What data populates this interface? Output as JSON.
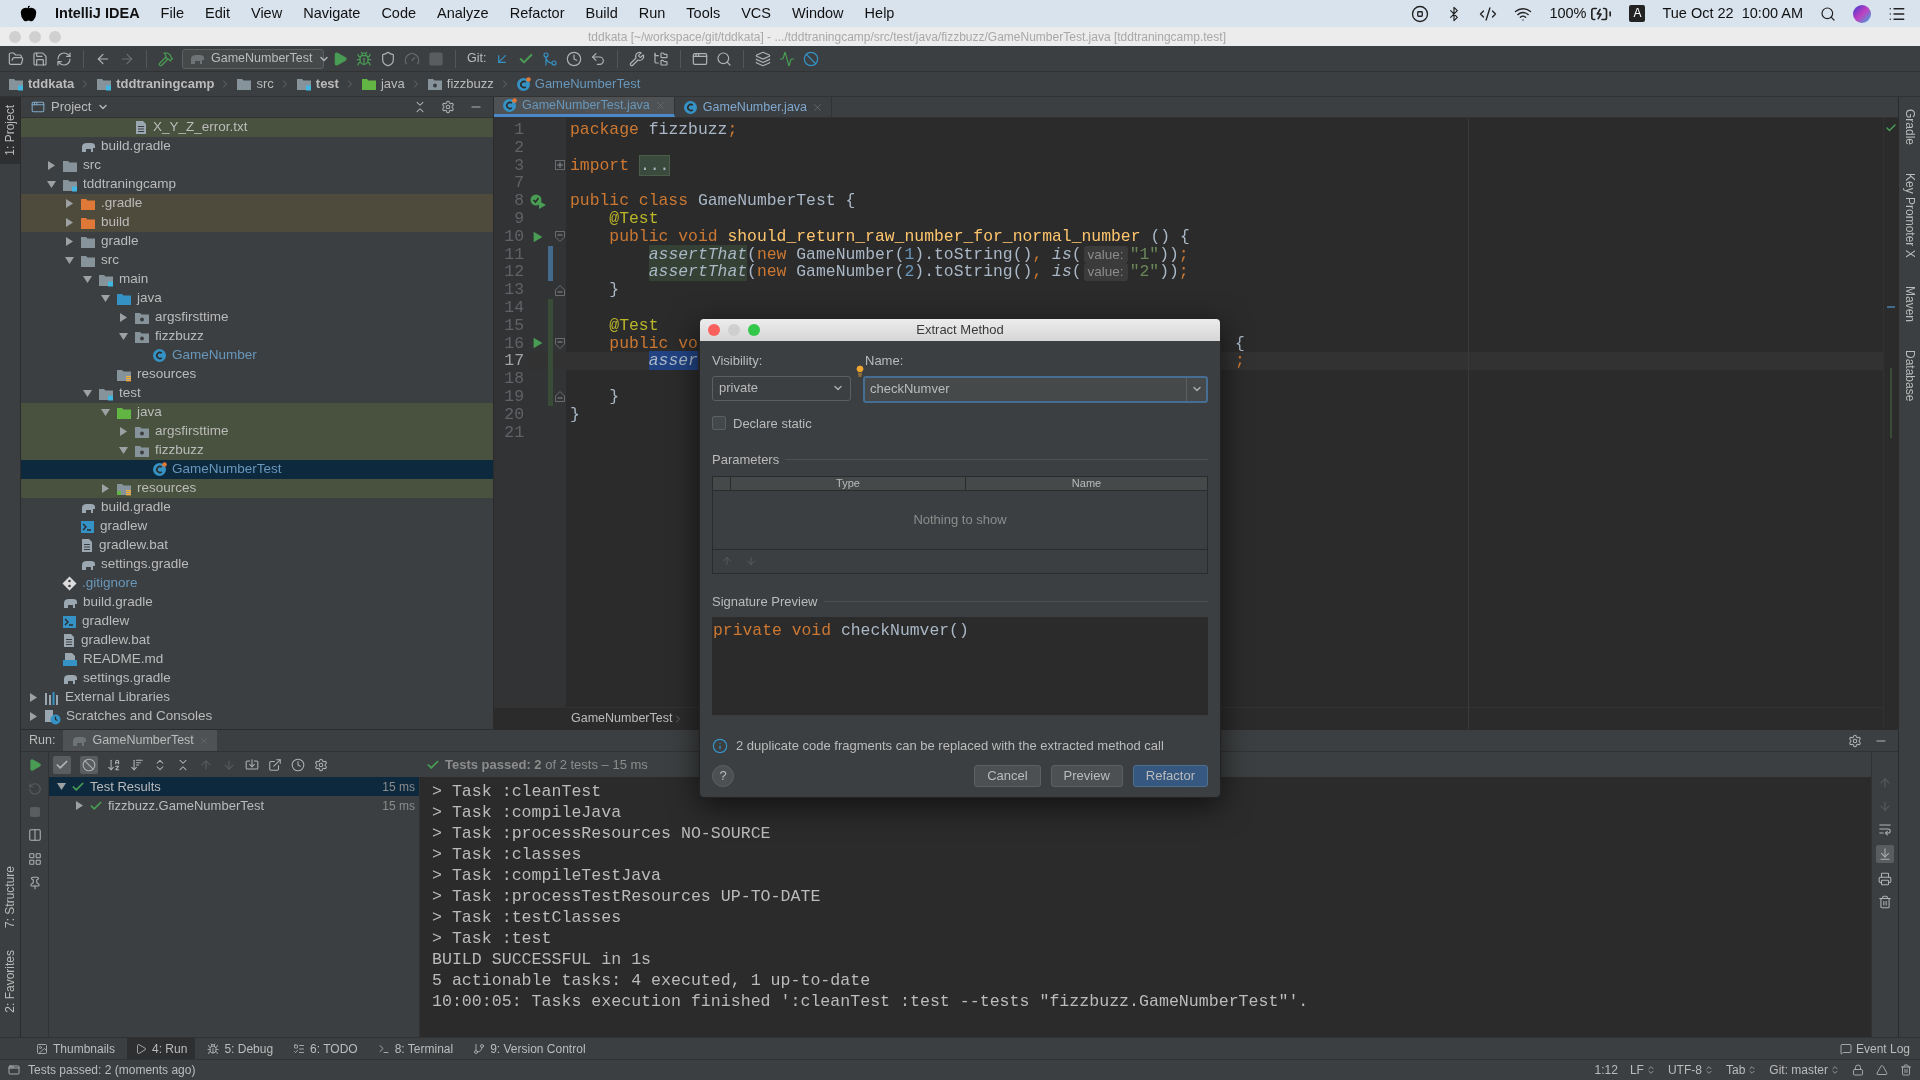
{
  "menu_bar": {
    "app": "IntelliJ IDEA",
    "menus": [
      "File",
      "Edit",
      "View",
      "Navigate",
      "Code",
      "Analyze",
      "Refactor",
      "Build",
      "Run",
      "Tools",
      "VCS",
      "Window",
      "Help"
    ],
    "battery": "100%",
    "input_source": "A",
    "clock": "Tue Oct 22  10:00 AM"
  },
  "window": {
    "title": "tddkata [~/workspace/git/tddkata] - .../tddtraningcamp/src/test/java/fizzbuzz/GameNumberTest.java [tddtraningcamp.test]"
  },
  "toolbar": {
    "run_config": "GameNumberTest",
    "git_label": "Git:"
  },
  "breadcrumbs": [
    {
      "label": "tddkata",
      "kind": "module"
    },
    {
      "label": "tddtraningcamp",
      "kind": "module"
    },
    {
      "label": "src",
      "kind": "folder"
    },
    {
      "label": "test",
      "kind": "module"
    },
    {
      "label": "java",
      "kind": "test_source"
    },
    {
      "label": "fizzbuzz",
      "kind": "package"
    },
    {
      "label": "GameNumberTest",
      "kind": "test_class"
    }
  ],
  "left_stripe": [
    {
      "label": "1: Project",
      "selected": true
    },
    {
      "label": "7: Structure",
      "selected": false
    },
    {
      "label": "2: Favorites",
      "selected": false
    }
  ],
  "right_stripe": [
    {
      "label": "Gradle",
      "selected": false
    },
    {
      "label": "Key Promoter X",
      "selected": false
    },
    {
      "label": "Maven",
      "selected": false
    },
    {
      "label": "Database",
      "selected": false
    }
  ],
  "project": {
    "title": "Project",
    "tree": [
      {
        "children": [
          {
            "children": [
              {
                "children": [
                  {
                    "children": [
                      {
                        "children": [
                          {
                            "label": "X_Y_Z_error.txt",
                            "kind": "text",
                            "selected": false,
                            "modified": false,
                            "color": "#49523f"
                          }
                        ]
                      }
                    ]
                  }
                ]
              },
              {
                "label": "build.gradle",
                "kind": "gradle",
                "selected": false,
                "modified": false
              }
            ]
          },
          {
            "label": "src",
            "kind": "folder",
            "expanded": false,
            "selected": false,
            "modified": false
          },
          {
            "label": "tddtraningcamp",
            "kind": "module",
            "expanded": true,
            "selected": false,
            "modified": false,
            "children": [
              {
                "label": ".gradle",
                "kind": "excluded",
                "expanded": false,
                "selected": false,
                "modified": false,
                "color": "#4e4a3c"
              },
              {
                "label": "build",
                "kind": "excluded",
                "expanded": false,
                "selected": false,
                "modified": false,
                "color": "#4e4a3c"
              },
              {
                "label": "gradle",
                "kind": "folder",
                "expanded": false,
                "selected": false,
                "modified": false
              },
              {
                "label": "src",
                "kind": "folder",
                "expanded": true,
                "selected": false,
                "modified": false,
                "children": [
                  {
                    "label": "main",
                    "kind": "module",
                    "expanded": true,
                    "selected": false,
                    "modified": false,
                    "children": [
                      {
                        "label": "java",
                        "kind": "source",
                        "expanded": true,
                        "selected": false,
                        "modified": false,
                        "children": [
                          {
                            "label": "argsfirsttime",
                            "kind": "package",
                            "expanded": false,
                            "selected": false,
                            "modified": false
                          },
                          {
                            "label": "fizzbuzz",
                            "kind": "package",
                            "expanded": true,
                            "selected": false,
                            "modified": false,
                            "children": [
                              {
                                "label": "GameNumber",
                                "kind": "class",
                                "selected": false,
                                "modified": true
                              }
                            ]
                          }
                        ]
                      },
                      {
                        "label": "resources",
                        "kind": "resources",
                        "selected": false,
                        "modified": false
                      }
                    ]
                  },
                  {
                    "label": "test",
                    "kind": "module",
                    "expanded": true,
                    "selected": false,
                    "modified": false,
                    "children": [
                      {
                        "label": "java",
                        "kind": "test_source",
                        "expanded": true,
                        "selected": false,
                        "modified": false,
                        "color": "#49523f",
                        "children": [
                          {
                            "label": "argsfirsttime",
                            "kind": "package",
                            "expanded": false,
                            "selected": false,
                            "modified": false,
                            "color": "#49523f"
                          },
                          {
                            "label": "fizzbuzz",
                            "kind": "package",
                            "expanded": true,
                            "selected": false,
                            "modified": false,
                            "color": "#49523f",
                            "children": [
                              {
                                "label": "GameNumberTest",
                                "kind": "test_class",
                                "selected": true,
                                "modified": true
                              }
                            ]
                          }
                        ]
                      },
                      {
                        "label": "resources",
                        "kind": "test_resources",
                        "expanded": false,
                        "selected": false,
                        "modified": false,
                        "color": "#49523f"
                      }
                    ]
                  }
                ]
              },
              {
                "label": "build.gradle",
                "kind": "gradle",
                "selected": false,
                "modified": false
              },
              {
                "label": "gradlew",
                "kind": "shell",
                "selected": false,
                "modified": false
              },
              {
                "label": "gradlew.bat",
                "kind": "text",
                "selected": false,
                "modified": false
              },
              {
                "label": "settings.gradle",
                "kind": "gradle",
                "selected": false,
                "modified": false
              }
            ]
          },
          {
            "label": ".gitignore",
            "kind": "git",
            "selected": false,
            "modified": true
          },
          {
            "label": "build.gradle",
            "kind": "gradle",
            "selected": false,
            "modified": false
          },
          {
            "label": "gradlew",
            "kind": "shell",
            "selected": false,
            "modified": false
          },
          {
            "label": "gradlew.bat",
            "kind": "text",
            "selected": false,
            "modified": false
          },
          {
            "label": "README.md",
            "kind": "markdown",
            "selected": false,
            "modified": false
          },
          {
            "label": "settings.gradle",
            "kind": "gradle",
            "selected": false,
            "modified": false
          }
        ]
      },
      {
        "label": "External Libraries",
        "kind": "libraries",
        "expanded": false,
        "selected": false,
        "modified": false
      },
      {
        "label": "Scratches and Consoles",
        "kind": "scratches",
        "expanded": false,
        "selected": false,
        "modified": false
      }
    ]
  },
  "editor": {
    "tabs": [
      {
        "label": "GameNumberTest.java",
        "kind": "test_class",
        "selected": true
      },
      {
        "label": "GameNumber.java",
        "kind": "class",
        "selected": false
      }
    ],
    "lines": [
      {
        "number": "1",
        "current": false,
        "segments": [
          {
            "text": "package",
            "kind": "keyword"
          },
          {
            "text": " fizzbuzz",
            "kind": "plain"
          },
          {
            "text": ";",
            "kind": "keyword"
          }
        ]
      },
      {
        "number": "2",
        "current": false
      },
      {
        "number": "3",
        "current": false,
        "markers": [
          {
            "kind": "fold_collapsed"
          }
        ],
        "segments": [
          {
            "text": "import",
            "kind": "keyword"
          },
          {
            "text": " ...",
            "kind": "folded"
          }
        ]
      },
      {
        "number": "7",
        "current": false
      },
      {
        "number": "8",
        "current": false,
        "markers": [
          {
            "kind": "run_passed"
          }
        ],
        "segments": [
          {
            "text": "public class",
            "kind": "keyword"
          },
          {
            "text": " GameNumberTest {",
            "kind": "plain"
          }
        ]
      },
      {
        "number": "9",
        "current": false,
        "segments": [
          {
            "text": "    @Test",
            "kind": "annotation"
          }
        ]
      },
      {
        "number": "10",
        "current": false,
        "markers": [
          {
            "kind": "run"
          },
          {
            "kind": "fold_open"
          }
        ],
        "segments": [
          {
            "text": "    public void",
            "kind": "keyword"
          },
          {
            "text": " should_return_raw_number_for_normal_number",
            "kind": "declaration"
          },
          {
            "text": " () {",
            "kind": "plain"
          }
        ]
      },
      {
        "number": "11",
        "current": false,
        "markers": [
          {
            "kind": "modified"
          }
        ],
        "segments": [
          {
            "text": "        assertThat",
            "kind": "duplicate"
          },
          {
            "text": "(",
            "kind": "plain"
          },
          {
            "text": "new",
            "kind": "keyword"
          },
          {
            "text": " GameNumber(",
            "kind": "plain"
          },
          {
            "text": "1",
            "kind": "number"
          },
          {
            "text": ").toString()",
            "kind": "plain"
          },
          {
            "text": ",",
            "kind": "keyword"
          },
          {
            "text": " is",
            "kind": "static"
          },
          {
            "text": "(",
            "kind": "plain"
          },
          {
            "text": "value:",
            "kind": "hint"
          },
          {
            "text": "\"1\"",
            "kind": "string"
          },
          {
            "text": "))",
            "kind": "plain"
          },
          {
            "text": ";",
            "kind": "keyword"
          }
        ]
      },
      {
        "number": "12",
        "current": false,
        "markers": [
          {
            "kind": "modified"
          }
        ],
        "segments": [
          {
            "text": "        assertThat",
            "kind": "duplicate"
          },
          {
            "text": "(",
            "kind": "plain"
          },
          {
            "text": "new",
            "kind": "keyword"
          },
          {
            "text": " GameNumber(",
            "kind": "plain"
          },
          {
            "text": "2",
            "kind": "number"
          },
          {
            "text": ").toString()",
            "kind": "plain"
          },
          {
            "text": ",",
            "kind": "keyword"
          },
          {
            "text": " is",
            "kind": "static"
          },
          {
            "text": "(",
            "kind": "plain"
          },
          {
            "text": "value:",
            "kind": "hint"
          },
          {
            "text": "\"2\"",
            "kind": "string"
          },
          {
            "text": "))",
            "kind": "plain"
          },
          {
            "text": ";",
            "kind": "keyword"
          }
        ]
      },
      {
        "number": "13",
        "current": false,
        "markers": [
          {
            "kind": "fold_end"
          }
        ],
        "segments": [
          {
            "text": "    }",
            "kind": "plain"
          }
        ]
      },
      {
        "number": "14",
        "current": false,
        "markers": [
          {
            "kind": "added"
          }
        ]
      },
      {
        "number": "15",
        "current": false,
        "markers": [
          {
            "kind": "added"
          }
        ],
        "segments": [
          {
            "text": "    @Test",
            "kind": "annotation"
          }
        ]
      },
      {
        "number": "16",
        "current": false,
        "markers": [
          {
            "kind": "run"
          },
          {
            "kind": "added"
          },
          {
            "kind": "fold_open"
          }
        ],
        "segments": [
          {
            "text": "    public vo",
            "kind": "keyword"
          }
        ],
        "tail": {
          "text": "{",
          "kind": "plain"
        }
      },
      {
        "number": "17",
        "current": true,
        "markers": [
          {
            "kind": "added"
          }
        ],
        "segments": [
          {
            "text": "        asser",
            "kind": "selection"
          }
        ],
        "tail": {
          "text": ";",
          "kind": "keyword"
        }
      },
      {
        "number": "18",
        "current": false,
        "markers": [
          {
            "kind": "added"
          }
        ]
      },
      {
        "number": "19",
        "current": false,
        "markers": [
          {
            "kind": "added"
          },
          {
            "kind": "fold_end"
          }
        ],
        "segments": [
          {
            "text": "    }",
            "kind": "plain"
          }
        ]
      },
      {
        "number": "20",
        "current": false,
        "segments": [
          {
            "text": "}",
            "kind": "plain"
          }
        ]
      },
      {
        "number": "21",
        "current": false
      }
    ],
    "breadcrumb": "GameNumberTest"
  },
  "dialog": {
    "title": "Extract Method",
    "visibility": {
      "label": "Visibility:",
      "value": "private"
    },
    "name": {
      "label": "Name:",
      "value": "checkNumver"
    },
    "declare_static": {
      "label": "Declare static",
      "checked": false
    },
    "parameters": {
      "title": "Parameters",
      "columns": [
        "Type",
        "Name"
      ],
      "empty_text": "Nothing to show"
    },
    "signature_preview": {
      "title": "Signature Preview",
      "segments": [
        {
          "text": "private void",
          "kind": "keyword"
        },
        {
          "text": " checkNumver()",
          "kind": "plain"
        }
      ]
    },
    "info": "2 duplicate code fragments can be replaced with the extracted method call",
    "help": "?",
    "buttons": [
      {
        "label": "Cancel",
        "primary": false
      },
      {
        "label": "Preview",
        "primary": false
      },
      {
        "label": "Refactor",
        "primary": true
      }
    ]
  },
  "run": {
    "label": "Run:",
    "tab": "GameNumberTest",
    "summary": "**Tests passed: 2** of 2 tests – 15 ms",
    "tests": [
      {
        "label": "Test Results",
        "time": "15 ms",
        "expanded": true,
        "selected": true,
        "children": [
          {
            "label": "fizzbuzz.GameNumberTest",
            "time": "15 ms",
            "expanded": false,
            "selected": false
          }
        ]
      }
    ],
    "console": [
      "> Task :cleanTest",
      "> Task :compileJava",
      "> Task :processResources NO-SOURCE",
      "> Task :classes",
      "> Task :compileTestJava",
      "> Task :processTestResources UP-TO-DATE",
      "> Task :testClasses",
      "> Task :test",
      "BUILD SUCCESSFUL in 1s",
      "5 actionable tasks: 4 executed, 1 up-to-date",
      "10:00:05: Tasks execution finished ':cleanTest :test --tests \"fizzbuzz.GameNumberTest\"'."
    ]
  },
  "tool_tabs": [
    {
      "label": "Thumbnails",
      "kind": "image",
      "selected": false
    },
    {
      "label": "4: Run",
      "kind": "run",
      "selected": true
    },
    {
      "label": "5: Debug",
      "kind": "debug",
      "selected": false
    },
    {
      "label": "6: TODO",
      "kind": "todo",
      "selected": false
    },
    {
      "label": "8: Terminal",
      "kind": "terminal",
      "selected": false
    },
    {
      "label": "9: Version Control",
      "kind": "vcs",
      "selected": false
    }
  ],
  "event_log": "Event Log",
  "status_bar": {
    "message": "Tests passed: 2 (moments ago)",
    "position": "1:12",
    "items": [
      "LF",
      "UTF-8",
      "Tab",
      "Git: master"
    ]
  }
}
